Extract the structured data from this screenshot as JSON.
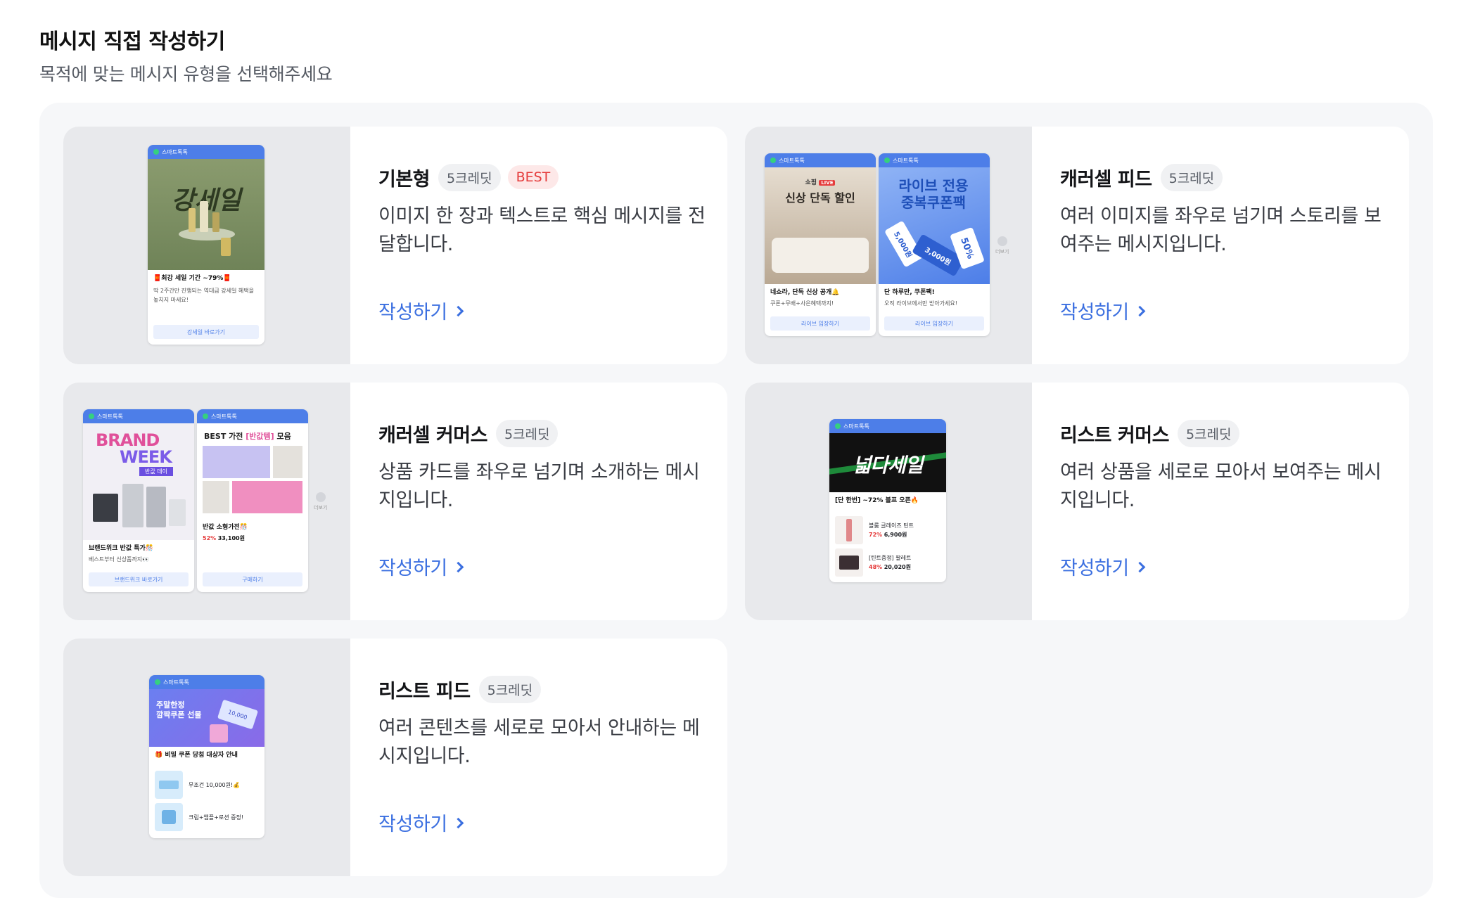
{
  "header": {
    "title": "메시지 직접 작성하기",
    "subtitle": "목적에 맞는 메시지 유형을 선택해주세요"
  },
  "colors": {
    "accent": "#3b6fe0",
    "best_badge": "#e53b3b",
    "preview_header": "#4d7ee8"
  },
  "cards": [
    {
      "title": "기본형",
      "credit": "5크레딧",
      "best": "BEST",
      "desc": "이미지 한 장과 텍스트로 핵심 메시지를 전달합니다.",
      "cta": "작성하기",
      "preview": {
        "brand": "스마트톡톡",
        "image_text": "강세일",
        "headline": "🧧최강 세일 기간 ~79%🧧",
        "body": "딱 2주간만 진행되는 역대급 강세일 혜택을 놓치지 마세요!",
        "button": "강세일 바로가기"
      }
    },
    {
      "title": "캐러셀 피드",
      "credit": "5크레딧",
      "desc": "여러 이미지를 좌우로 넘기며 스토리를 보여주는 메시지입니다.",
      "cta": "작성하기",
      "preview": {
        "brand": "스마트톡톡",
        "slides": [
          {
            "tag": "쇼핑",
            "live": "LIVE",
            "image_text": "신상 단독 할인",
            "headline": "네쇼라, 단독 신상 공개🔔",
            "body": "쿠폰+무배+사은혜택까지!",
            "button": "라이브 입장하기"
          },
          {
            "image_text": "라이브 전용 중복쿠폰팩",
            "coupons": [
              "5,000원",
              "3,000원",
              "50%"
            ],
            "headline": "단 하루만, 쿠폰팩!",
            "body": "오직 라이브에서만 받아가세요!",
            "button": "라이브 입장하기"
          }
        ],
        "more": "더보기"
      }
    },
    {
      "title": "캐러셀 커머스",
      "credit": "5크레딧",
      "desc": "상품 카드를 좌우로 넘기며 소개하는 메시지입니다.",
      "cta": "작성하기",
      "preview": {
        "brand": "스마트톡톡",
        "slides": [
          {
            "image_line1": "BRAND",
            "image_line2": "WEEK",
            "image_tag": "반값 데이",
            "headline": "브랜드위크 반값 특가🎊",
            "body": "베스트부터 신상품까지👀",
            "button": "브랜드위크 바로가기"
          },
          {
            "image_title": "BEST 가전",
            "image_highlight": "[반값템]",
            "image_suffix": "모음",
            "headline": "반값 소형가전🎊",
            "discount": "52%",
            "price": "33,100원",
            "button": "구매하기"
          }
        ],
        "more": "더보기"
      }
    },
    {
      "title": "리스트 커머스",
      "credit": "5크레딧",
      "desc": "여러 상품을 세로로 모아서 보여주는 메시지입니다.",
      "cta": "작성하기",
      "preview": {
        "brand": "스마트톡톡",
        "image_text": "넓다세일",
        "headline": "[단 한번] ~72% 블프 오픈🔥",
        "items": [
          {
            "name": "블룸 글레이즈 틴트",
            "discount": "72%",
            "price": "6,900원"
          },
          {
            "name": "[틴트증정] 팔레트",
            "discount": "48%",
            "price": "20,020원"
          }
        ]
      }
    },
    {
      "title": "리스트 피드",
      "credit": "5크레딧",
      "desc": "여러 콘텐츠를 세로로 모아서 안내하는 메시지입니다.",
      "cta": "작성하기",
      "preview": {
        "brand": "스마트톡톡",
        "image_small": "주말한정",
        "image_text": "깜짝쿠폰 선물",
        "ticket": "10,000",
        "headline": "🎁 비밀 쿠폰 당첨 대상자 안내",
        "items": [
          {
            "text": "무조건 10,000원!💰"
          },
          {
            "text": "크림+앰플+로션 증정!"
          }
        ]
      }
    }
  ]
}
